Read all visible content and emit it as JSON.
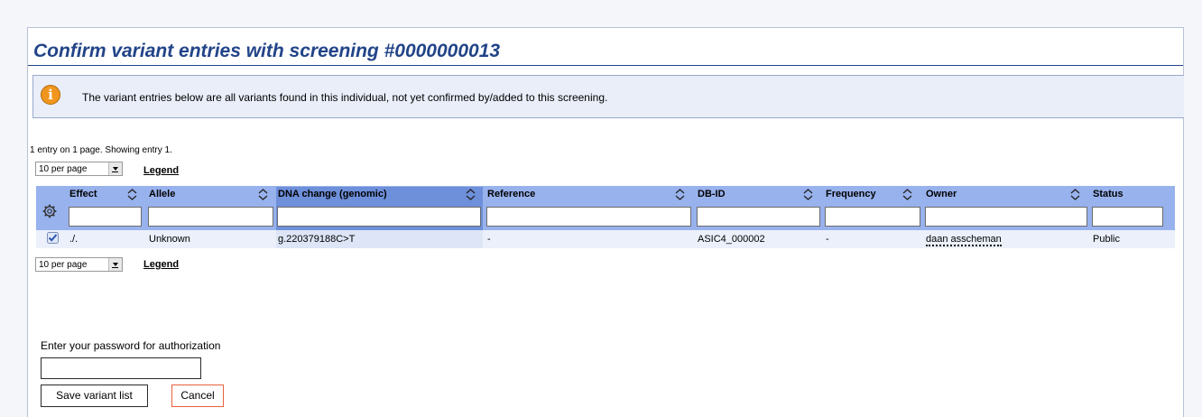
{
  "page": {
    "title": "Confirm variant entries with screening #0000000013",
    "info_message": "The variant entries below are all variants found in this individual, not yet confirmed by/added to this screening.",
    "entries_summary": "1 entry on 1 page. Showing entry 1."
  },
  "pagination": {
    "per_page": "10 per page",
    "legend_label": "Legend"
  },
  "table": {
    "columns": [
      "Effect",
      "Allele",
      "DNA change (genomic)",
      "Reference",
      "DB-ID",
      "Frequency",
      "Owner",
      "Status"
    ],
    "active_sort_column": "DNA change (genomic)",
    "rows": [
      {
        "checked": true,
        "effect": "./.",
        "allele": "Unknown",
        "dna_change": "g.220379188C>T",
        "reference": "-",
        "db_id": "ASIC4_000002",
        "frequency": "-",
        "owner": "daan asscheman",
        "status": "Public"
      }
    ]
  },
  "form": {
    "password_label": "Enter your password for authorization",
    "password_value": "",
    "save_label": "Save variant list",
    "cancel_label": "Cancel"
  },
  "colors": {
    "title": "#224488",
    "header_bg": "#98b2ed",
    "active_header_bg": "#6e8fda",
    "info_bg": "#e9eef9",
    "info_icon": "#f0961e",
    "cancel_border": "#e8603c"
  },
  "icons": [
    "info-icon",
    "gear-icon",
    "sort-icon",
    "checkbox-checked-icon",
    "dropdown-arrow-icon"
  ]
}
